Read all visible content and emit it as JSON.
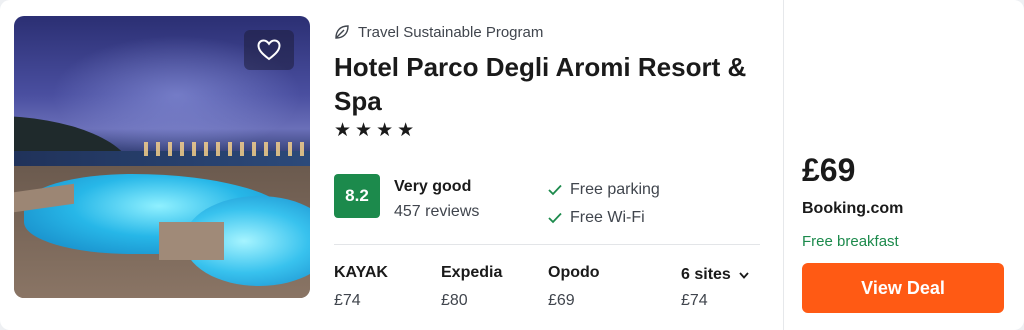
{
  "hotel": {
    "program": "Travel Sustainable Program",
    "name": "Hotel Parco Degli Aromi Resort & Spa",
    "stars": "★★★★",
    "score": "8.2",
    "rating_label": "Very good",
    "reviews": "457 reviews",
    "amenities": [
      "Free parking",
      "Free Wi-Fi"
    ]
  },
  "providers": [
    {
      "name": "KAYAK",
      "price": "£74"
    },
    {
      "name": "Expedia",
      "price": "£80"
    },
    {
      "name": "Opodo",
      "price": "£69"
    },
    {
      "name": "6 sites",
      "price": "£74"
    }
  ],
  "deal": {
    "price": "£69",
    "site": "Booking.com",
    "perk": "Free breakfast",
    "button_label": "View Deal"
  },
  "colors": {
    "score_bg": "#1c8a4c",
    "deal_button": "#ff5a14",
    "perk_text": "#1c8a4c"
  },
  "icons": {
    "favorite": "heart-icon",
    "program": "leaf-icon",
    "amenity": "check-icon",
    "expand": "chevron-down-icon"
  }
}
